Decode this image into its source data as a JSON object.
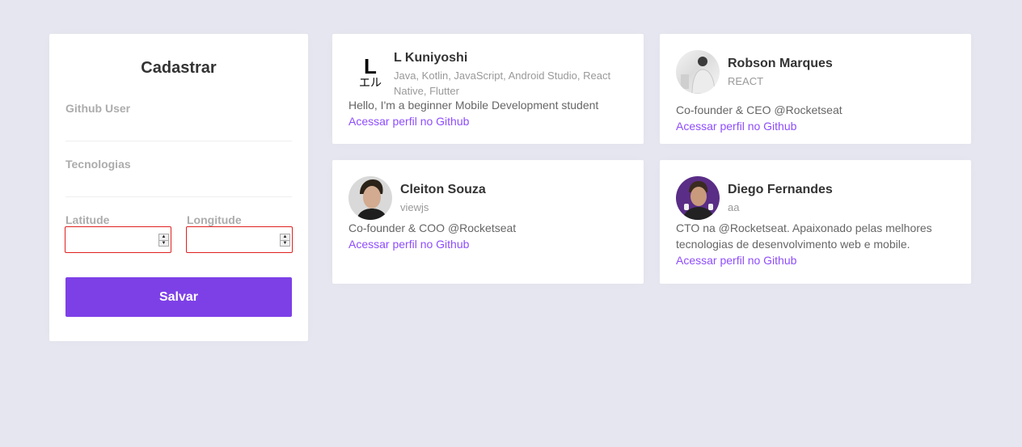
{
  "form": {
    "title": "Cadastrar",
    "github_label": "Github User",
    "github_value": "",
    "techs_label": "Tecnologias",
    "techs_value": "",
    "latitude_label": "Latitude",
    "latitude_value": "",
    "longitude_label": "Longitude",
    "longitude_value": "",
    "save_label": "Salvar"
  },
  "colors": {
    "background": "#e6e6f0",
    "accent": "#7d40e7",
    "link": "#8e4dff",
    "invalid_border": "#e02020"
  },
  "devs": [
    {
      "name": "L Kuniyoshi",
      "techs": "Java, Kotlin, JavaScript, Android Studio, React Native, Flutter",
      "bio": "Hello, I'm a beginner Mobile Development student",
      "link_label": "Acessar perfil no Github",
      "avatar_text_top": "L",
      "avatar_text_bottom": "エル"
    },
    {
      "name": "Robson Marques",
      "techs": "REACT",
      "bio": "Co-founder & CEO @Rocketseat",
      "link_label": "Acessar perfil no Github"
    },
    {
      "name": "Cleiton Souza",
      "techs": "viewjs",
      "bio": "Co-founder & COO @Rocketseat",
      "link_label": "Acessar perfil no Github"
    },
    {
      "name": "Diego Fernandes",
      "techs": "aa",
      "bio": "CTO na @Rocketseat. Apaixonado pelas melhores tecnologias de desenvolvimento web e mobile.",
      "link_label": "Acessar perfil no Github"
    }
  ]
}
